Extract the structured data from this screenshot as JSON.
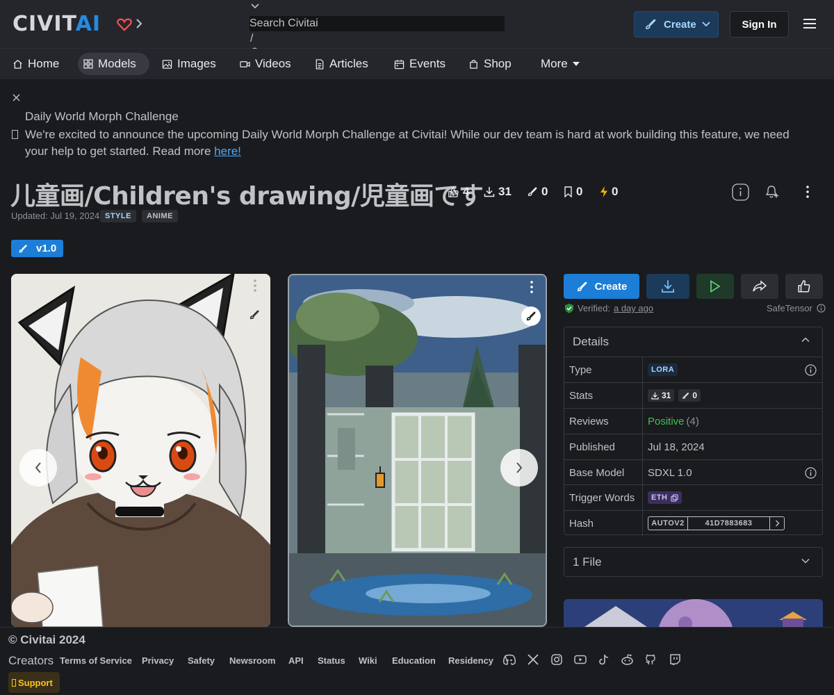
{
  "header": {
    "logo_main": "CIVIT",
    "logo_accent": "AI",
    "search_placeholder": "Search Civitai",
    "search_shortcut": "/",
    "create_label": "Create",
    "signin_label": "Sign In"
  },
  "nav": {
    "items": [
      {
        "label": "Home",
        "icon": "home-icon"
      },
      {
        "label": "Models",
        "icon": "grid-icon",
        "active": true
      },
      {
        "label": "Images",
        "icon": "photo-icon"
      },
      {
        "label": "Videos",
        "icon": "video-icon"
      },
      {
        "label": "Articles",
        "icon": "file-text-icon"
      },
      {
        "label": "Events",
        "icon": "calendar-icon"
      },
      {
        "label": "Shop",
        "icon": "shopping-bag-icon"
      },
      {
        "label": "More",
        "icon": "caret-down-icon"
      }
    ]
  },
  "announcement": {
    "title": "Daily World Morph Challenge",
    "body": "We're excited to announce the upcoming Daily World Morph Challenge at Civitai! While our dev team is hard at work building this feature, we need your help to get started. Read more ",
    "link": "here!"
  },
  "model": {
    "title": "儿童画/Children's drawing/児童画です",
    "stats": {
      "likes": "4",
      "downloads": "31",
      "generations": "0",
      "bookmarks": "0",
      "buzz": "0"
    },
    "updated": "Updated: Jul 19, 2024",
    "tags": [
      "STYLE",
      "ANIME"
    ],
    "version": "v1.0"
  },
  "actions": {
    "create_label": "Create",
    "verified_label": "Verified:",
    "verified_when": "a day ago",
    "safetensor": "SafeTensor"
  },
  "details": {
    "heading": "Details",
    "rows": {
      "type_k": "Type",
      "type_v": "LORA",
      "stats_k": "Stats",
      "stats_dl": "31",
      "stats_gen": "0",
      "reviews_k": "Reviews",
      "reviews_v": "Positive",
      "reviews_count": "(4)",
      "published_k": "Published",
      "published_v": "Jul 18, 2024",
      "base_k": "Base Model",
      "base_v": "SDXL 1.0",
      "trigger_k": "Trigger Words",
      "trigger_v": "ETH",
      "hash_k": "Hash",
      "hash_type": "AUTOV2",
      "hash_value": "41D7883683"
    }
  },
  "files": {
    "label": "1 File"
  },
  "footer": {
    "copyright": "© Civitai 2024",
    "creators": "Creators",
    "links": [
      "Terms of Service",
      "Privacy",
      "Safety",
      "Newsroom",
      "API",
      "Status",
      "Wiki",
      "Education",
      "Residency"
    ],
    "social_icons": [
      "discord-icon",
      "x-icon",
      "instagram-icon",
      "youtube-icon",
      "tiktok-icon",
      "reddit-icon",
      "github-icon",
      "twitch-icon"
    ],
    "support": "Support"
  },
  "colors": {
    "accent": "#1c7ed6",
    "background": "#1a1b1e",
    "positive": "#40c057"
  }
}
